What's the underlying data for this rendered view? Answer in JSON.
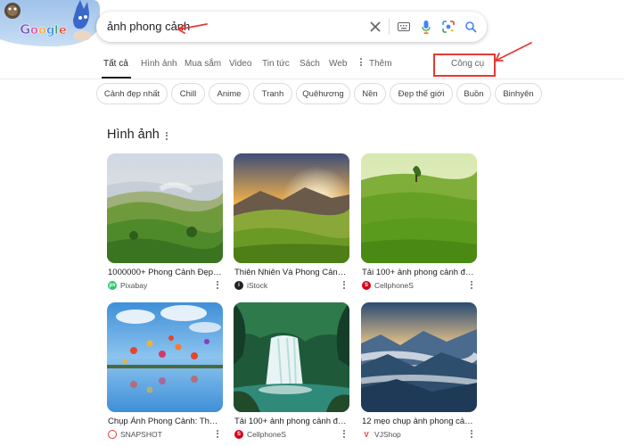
{
  "doodle": {
    "logo_text": "Google"
  },
  "search": {
    "query": "ảnh phong cảnh",
    "icons": [
      "clear-icon",
      "keyboard-icon",
      "microphone-icon",
      "google-lens-icon",
      "search-icon"
    ]
  },
  "tabs": [
    {
      "label": "Tất cả",
      "active": true
    },
    {
      "label": "Hình ảnh",
      "active": false
    },
    {
      "label": "Mua sắm",
      "active": false
    },
    {
      "label": "Video",
      "active": false
    },
    {
      "label": "Tin tức",
      "active": false
    },
    {
      "label": "Sách",
      "active": false
    },
    {
      "label": "Web",
      "active": false
    },
    {
      "label": "Thêm",
      "active": false
    }
  ],
  "tools": {
    "label": "Công cụ"
  },
  "chips": [
    "Cảnh đẹp nhất",
    "Chill",
    "Anime",
    "Tranh",
    "Quêhương",
    "Nền",
    "Đẹp thế giới",
    "Buồn",
    "Binhyên"
  ],
  "images_section": {
    "title": "Hình ảnh"
  },
  "image_results": [
    {
      "title": "1000000+ Phong Cảnh Đẹp & ...",
      "source": "Pixabay",
      "favicon_color": "#2ec66d",
      "favicon_letter": "px"
    },
    {
      "title": "Thiên Nhiên Và Phong Cảnh Hì...",
      "source": "iStock",
      "favicon_color": "#202124",
      "favicon_letter": "i"
    },
    {
      "title": "Tải 100+ ảnh phong cảnh đẹp ...",
      "source": "CellphoneS",
      "favicon_color": "#d70018",
      "favicon_letter": "S"
    },
    {
      "title": "Chụp Ảnh Phong Cảnh: Thủ T...",
      "source": "SNAPSHOT",
      "favicon_color": "#e53935",
      "favicon_letter": ""
    },
    {
      "title": "Tải 100+ ảnh phong cảnh đẹp ...",
      "source": "CellphoneS",
      "favicon_color": "#d70018",
      "favicon_letter": "S"
    },
    {
      "title": "12 mẹo chụp ảnh phong cảnh ...",
      "source": "VJShop",
      "favicon_color": "#ffffff",
      "favicon_letter": "V"
    }
  ],
  "colors": {
    "annotation_red": "#e53935",
    "text_primary": "#202124",
    "text_secondary": "#5f6368"
  }
}
